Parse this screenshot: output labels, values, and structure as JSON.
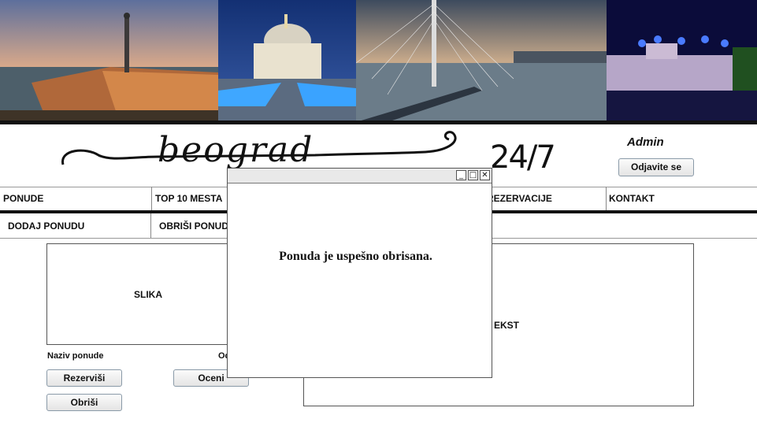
{
  "header": {
    "photos": [
      "belgrade-fortress-photo",
      "saint-sava-temple-photo",
      "ada-bridge-photo",
      "fortress-night-concert-photo"
    ],
    "logo_text": "beograd",
    "logo_suffix": "24/7",
    "admin_name": "Admin",
    "logout_label": "Odjavite se"
  },
  "nav": {
    "items": [
      "PONUDE",
      "TOP 10 MESTA",
      "REZERVACIJE",
      "KONTAKT"
    ]
  },
  "subnav": {
    "items": [
      "DODAJ PONUDU",
      "OBRIŠI PONUDU"
    ]
  },
  "offer": {
    "image_label": "SLIKA",
    "name_label": "Naziv ponude",
    "rating_label": "Oc",
    "reserve_button": "Rezerviši",
    "rate_button": "Oceni",
    "delete_button": "Obriši",
    "text_label": "EKST"
  },
  "modal": {
    "message": "Ponuda je uspešno obrisana.",
    "minimize_glyph": "_",
    "maximize_glyph": "□",
    "close_glyph": "✕"
  }
}
